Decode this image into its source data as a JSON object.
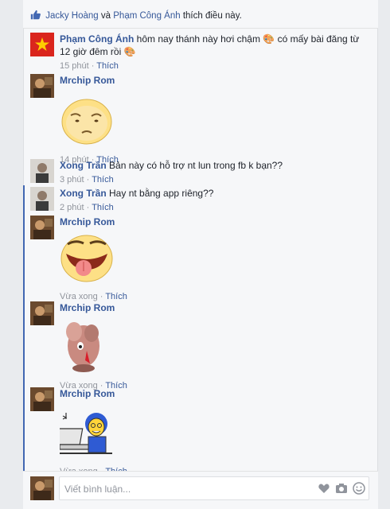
{
  "likes": {
    "user1": "Jacky Hoàng",
    "connector": "và",
    "user2": "Phạm Công Ánh",
    "suffix": "thích điều này."
  },
  "comments": [
    {
      "name": "Phạm Công Ánh",
      "text": "hôm nay thánh này hơi chậm",
      "text2": "có mấy bài đăng từ 12 giờ",
      "text3": "đêm rồi",
      "time": "15 phút",
      "action": "Thích"
    },
    {
      "name": "Mrchip Rom",
      "time": "14 phút",
      "action": "Thích"
    },
    {
      "name": "Xong Trần",
      "text": "Bản này có hỗ trợ nt lun trong fb k bạn??",
      "time": "3 phút",
      "action": "Thích"
    },
    {
      "name": "Xong Trần",
      "text": "Hay nt bằng app riêng??",
      "time": "2 phút",
      "action": "Thích"
    },
    {
      "name": "Mrchip Rom",
      "time": "Vừa xong",
      "action": "Thích"
    },
    {
      "name": "Mrchip Rom",
      "time": "Vừa xong",
      "action": "Thích"
    },
    {
      "name": "Mrchip Rom",
      "time": "Vừa xong",
      "action": "Thích"
    }
  ],
  "composer": {
    "placeholder": "Viết bình luận..."
  },
  "separator": "·",
  "colors": {
    "link": "#365899",
    "meta": "#90949c",
    "thread": "#4267b2"
  }
}
